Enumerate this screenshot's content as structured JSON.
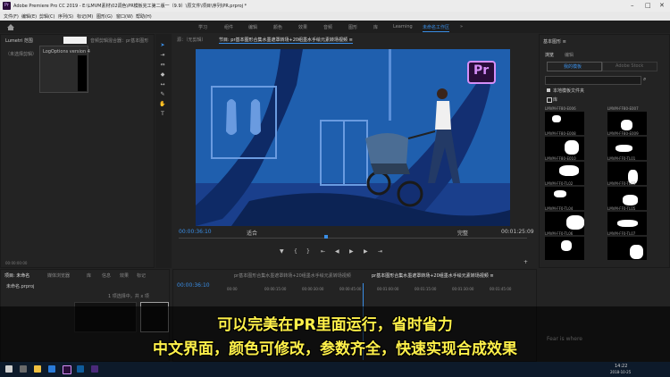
{
  "window": {
    "app_icon": "Pr",
    "title": "Adobe Premiere Pro CC 2019 - E:\\LMVM素材\\02调色\\PR模板完工第二版一（9.9）\\原文件\\项目\\序列\\PR.prproj *"
  },
  "menu": [
    "文件(F)",
    "编辑(E)",
    "剪辑(C)",
    "序列(S)",
    "标记(M)",
    "图形(G)",
    "窗口(W)",
    "帮助(H)"
  ],
  "workspaces": [
    "学习",
    "组件",
    "编辑",
    "颜色",
    "效果",
    "音频",
    "图形",
    "库",
    "Learning",
    "未命名工作区",
    "»"
  ],
  "active_workspace": "未命名工作区",
  "left_panel": {
    "tabs": [
      "Lumetri 范围",
      "源：（无剪辑）",
      "效果控件",
      "音频剪辑混合器：pr基本图形"
    ],
    "dropdown_item": "LogOptions version 4",
    "sub_label": "（未选择剪辑）",
    "footer_time": "00:00:00:00"
  },
  "program_monitor": {
    "tab_label": "节目: pr基本图形合集水墨遮罩转场+20组墨水手绘元素转场视频 ≡",
    "source_label": "源：（无剪辑）",
    "pr_badge": "Pr",
    "timecode_left": "00:00:36:10",
    "fit_label": "适合",
    "quality_label": "完整",
    "timecode_right": "00:01:25:09"
  },
  "essential_graphics": {
    "title": "基本图形 ≡",
    "tabs": [
      "浏览",
      "编辑"
    ],
    "buttons": [
      "我的模板",
      "Adobe Stock"
    ],
    "options": [
      "本地模板文件夹",
      "库"
    ],
    "thumbs": [
      {
        "label": "LMVM-FF80-E006"
      },
      {
        "label": "LMVM-FF80-E007"
      },
      {
        "label": "LMVM-FF80-E008"
      },
      {
        "label": "LMVM-FF80-E009"
      },
      {
        "label": "LMVM-FF80-E010"
      },
      {
        "label": "LMVM-FF0-TL01"
      },
      {
        "label": "LMVM-FF0-TL02"
      },
      {
        "label": "LMVM-FF0-TL03"
      },
      {
        "label": "LMVM-FF0-TL04"
      },
      {
        "label": "LMVM-FF0-TL05"
      },
      {
        "label": "LMVM-FF0-TL06"
      },
      {
        "label": "LMVM-FF0-TL07"
      }
    ],
    "faded_caption": "Fear is where"
  },
  "project_panel": {
    "tabs": [
      "项目: 未命名",
      "媒体浏览器",
      "库",
      "信息",
      "效果",
      "标记"
    ],
    "file": "未命名.prproj",
    "count": "1 项选择中，共 x 项"
  },
  "timeline": {
    "tabs": [
      "pr基本图形合集水墨遮罩转场+20组墨水手绘元素转场视频",
      "pr基本图形合集水墨遮罩转场+20组墨水手绘元素转场视频 ≡"
    ],
    "timecode": "00:00:36:10",
    "ruler": [
      "00:00",
      "00:00:15:00",
      "00:00:30:00",
      "00:00:45:00",
      "00:01:00:00",
      "00:01:15:00",
      "00:01:30:00",
      "00:01:45:00"
    ]
  },
  "overlay": {
    "line1": "可以完美在PR里面运行，省时省力",
    "line2": "中文界面，颜色可修改，参数齐全，快速实现合成效果"
  },
  "taskbar": {
    "time": "2018-10-25",
    "clock": "14:22"
  },
  "colors": {
    "accent": "#3a8ee6",
    "video_bg": "#1f5fae",
    "overlay_text": "#fff14a"
  }
}
